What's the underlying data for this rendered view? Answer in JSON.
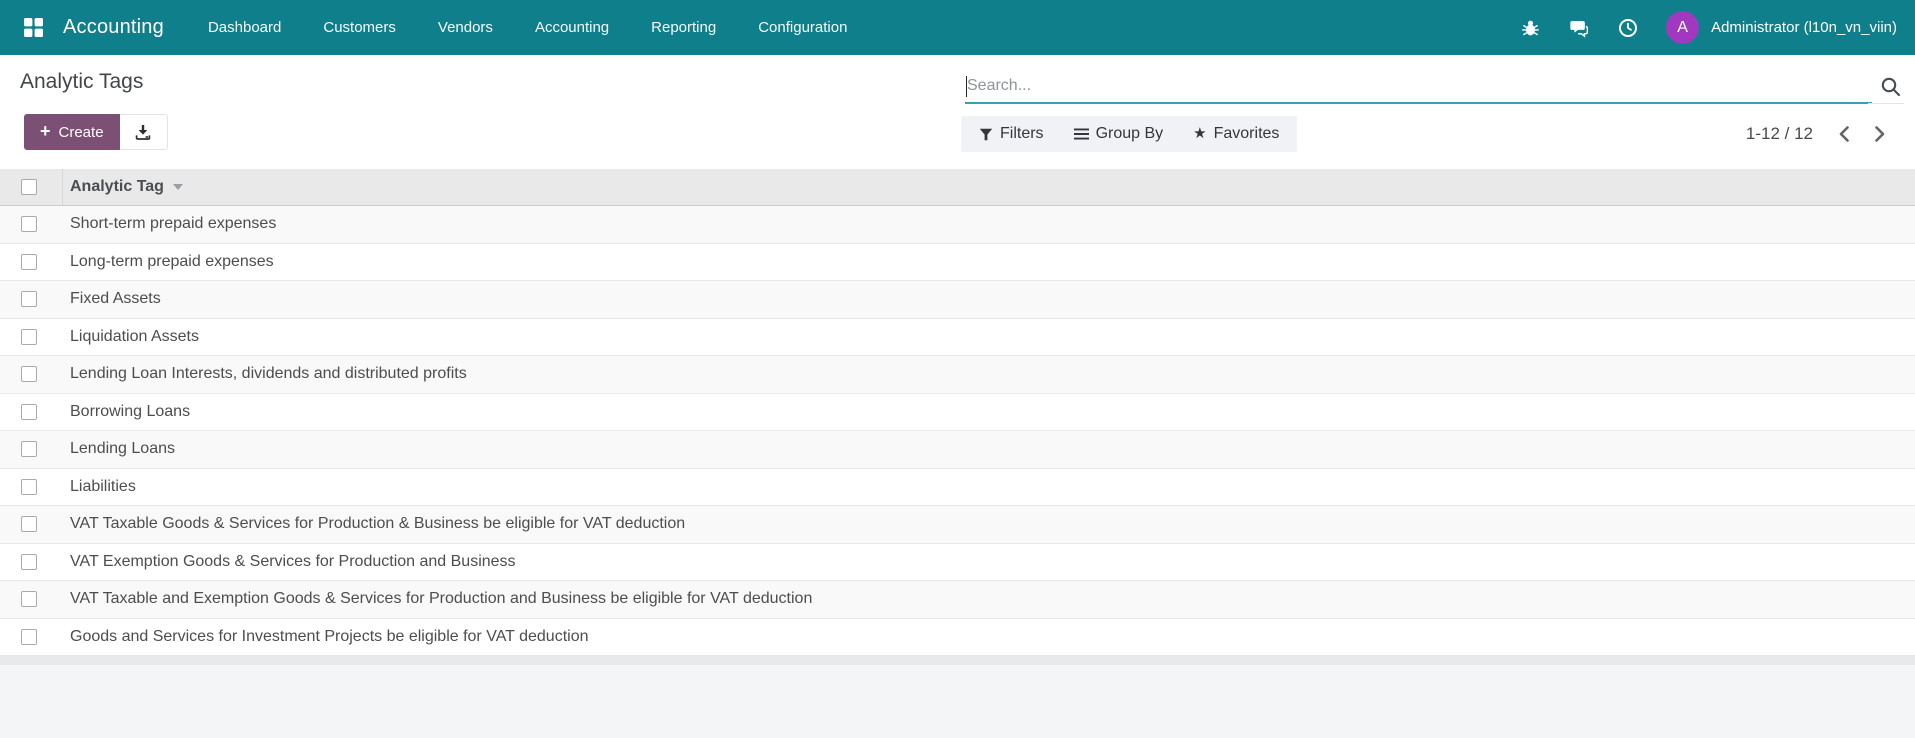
{
  "navbar": {
    "brand": "Accounting",
    "menu": [
      "Dashboard",
      "Customers",
      "Vendors",
      "Accounting",
      "Reporting",
      "Configuration"
    ],
    "user_initial": "A",
    "user_name": "Administrator (l10n_vn_viin)"
  },
  "page": {
    "title": "Analytic Tags",
    "create_label": "Create"
  },
  "search": {
    "placeholder": "Search..."
  },
  "controls": {
    "filters": "Filters",
    "group_by": "Group By",
    "favorites": "Favorites"
  },
  "pagination": {
    "range": "1-12 / 12"
  },
  "table": {
    "header": "Analytic Tag",
    "rows": [
      "Short-term prepaid expenses",
      "Long-term prepaid expenses",
      "Fixed Assets",
      "Liquidation Assets",
      "Lending Loan Interests, dividends and distributed profits",
      "Borrowing Loans",
      "Lending Loans",
      "Liabilities",
      "VAT Taxable Goods & Services for Production & Business be eligible for VAT deduction",
      "VAT Exemption Goods & Services for Production and Business",
      "VAT Taxable and Exemption Goods & Services for Production and Business be eligible for VAT deduction",
      "Goods and Services for Investment Projects be eligible for VAT deduction"
    ]
  },
  "colors": {
    "navbar_bg": "#0e7f8b",
    "primary_button_bg": "#7c4f74",
    "avatar_bg": "#a039c0",
    "search_underline": "#35a2ad"
  }
}
